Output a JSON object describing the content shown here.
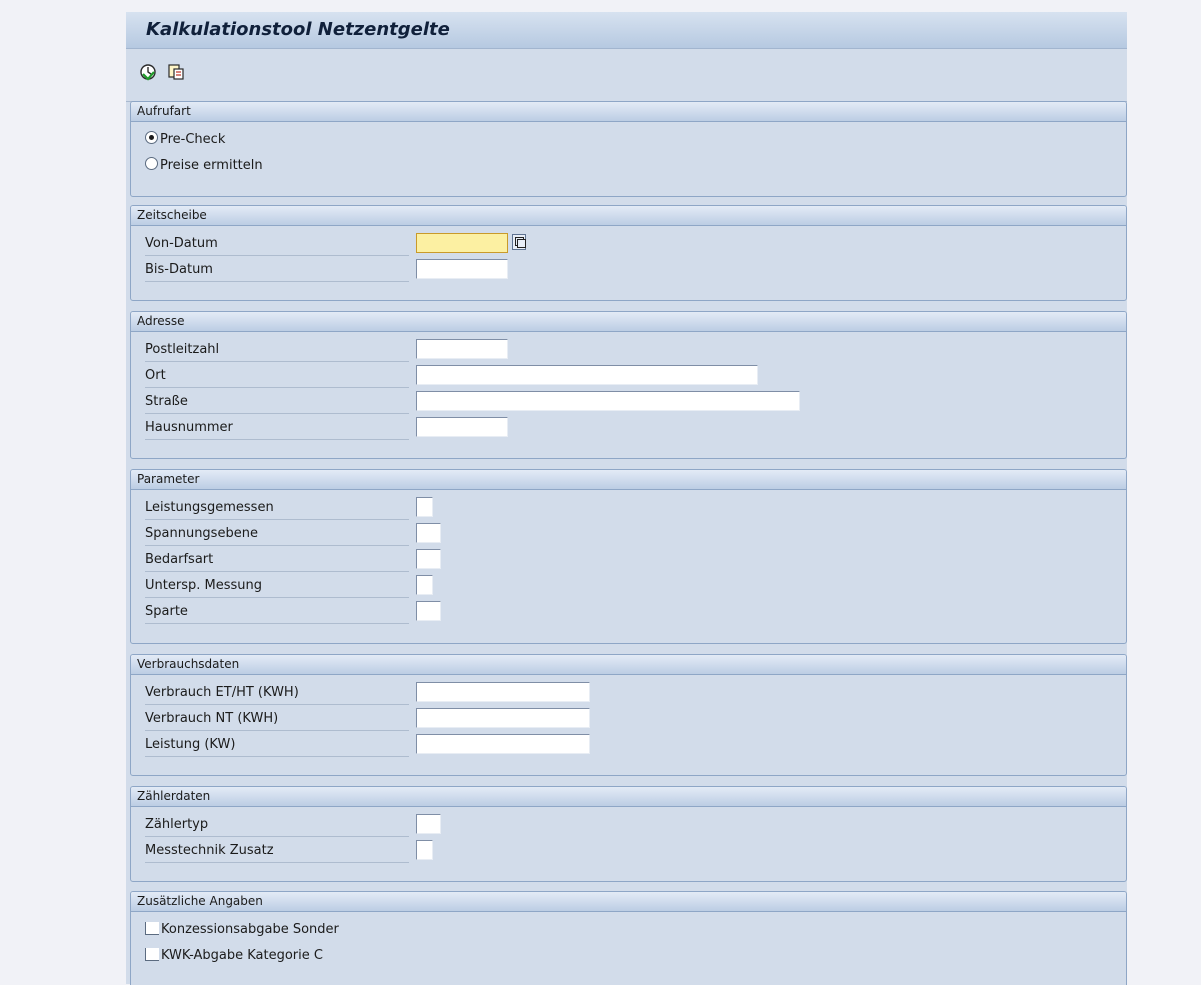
{
  "app": {
    "title": "Kalkulationstool Netzentgelte"
  },
  "toolbar": {
    "icons": [
      "execute-icon",
      "program-icon"
    ]
  },
  "aufrufart": {
    "header": "Aufrufart",
    "options": [
      "Pre-Check",
      "Preise ermitteln"
    ],
    "selected": "Pre-Check"
  },
  "zeitscheibe": {
    "header": "Zeitscheibe",
    "von_label": "Von-Datum",
    "von_value": "",
    "bis_label": "Bis-Datum",
    "bis_value": ""
  },
  "adresse": {
    "header": "Adresse",
    "plz_label": "Postleitzahl",
    "plz_value": "",
    "ort_label": "Ort",
    "ort_value": "",
    "strasse_label": "Straße",
    "strasse_value": "",
    "hausnummer_label": "Hausnummer",
    "hausnummer_value": ""
  },
  "parameter": {
    "header": "Parameter",
    "leistungsgemessen": "Leistungsgemessen",
    "spannungsebene": "Spannungsebene",
    "bedarfsart": "Bedarfsart",
    "untersp_messung": "Untersp. Messung",
    "sparte": "Sparte"
  },
  "verbrauchsdaten": {
    "header": "Verbrauchsdaten",
    "et_ht_label": "Verbrauch ET/HT (KWH)",
    "et_ht_value": "",
    "nt_label": "Verbrauch NT (KWH)",
    "nt_value": "",
    "leistung_label": "Leistung (KW)",
    "leistung_value": ""
  },
  "zaehlerdaten": {
    "header": "Zählerdaten",
    "zaehlertyp": "Zählertyp",
    "messtechnik": "Messtechnik Zusatz"
  },
  "zusaetzliche": {
    "header": "Zusätzliche Angaben",
    "konzession": "Konzessionsabgabe Sonder",
    "konzession_checked": false,
    "kwk": "KWK-Abgabe Kategorie C",
    "kwk_checked": false
  },
  "colors": {
    "accent": "#b6c9e1",
    "required_field": "#fcf0a2",
    "background": "#d2dcea"
  }
}
